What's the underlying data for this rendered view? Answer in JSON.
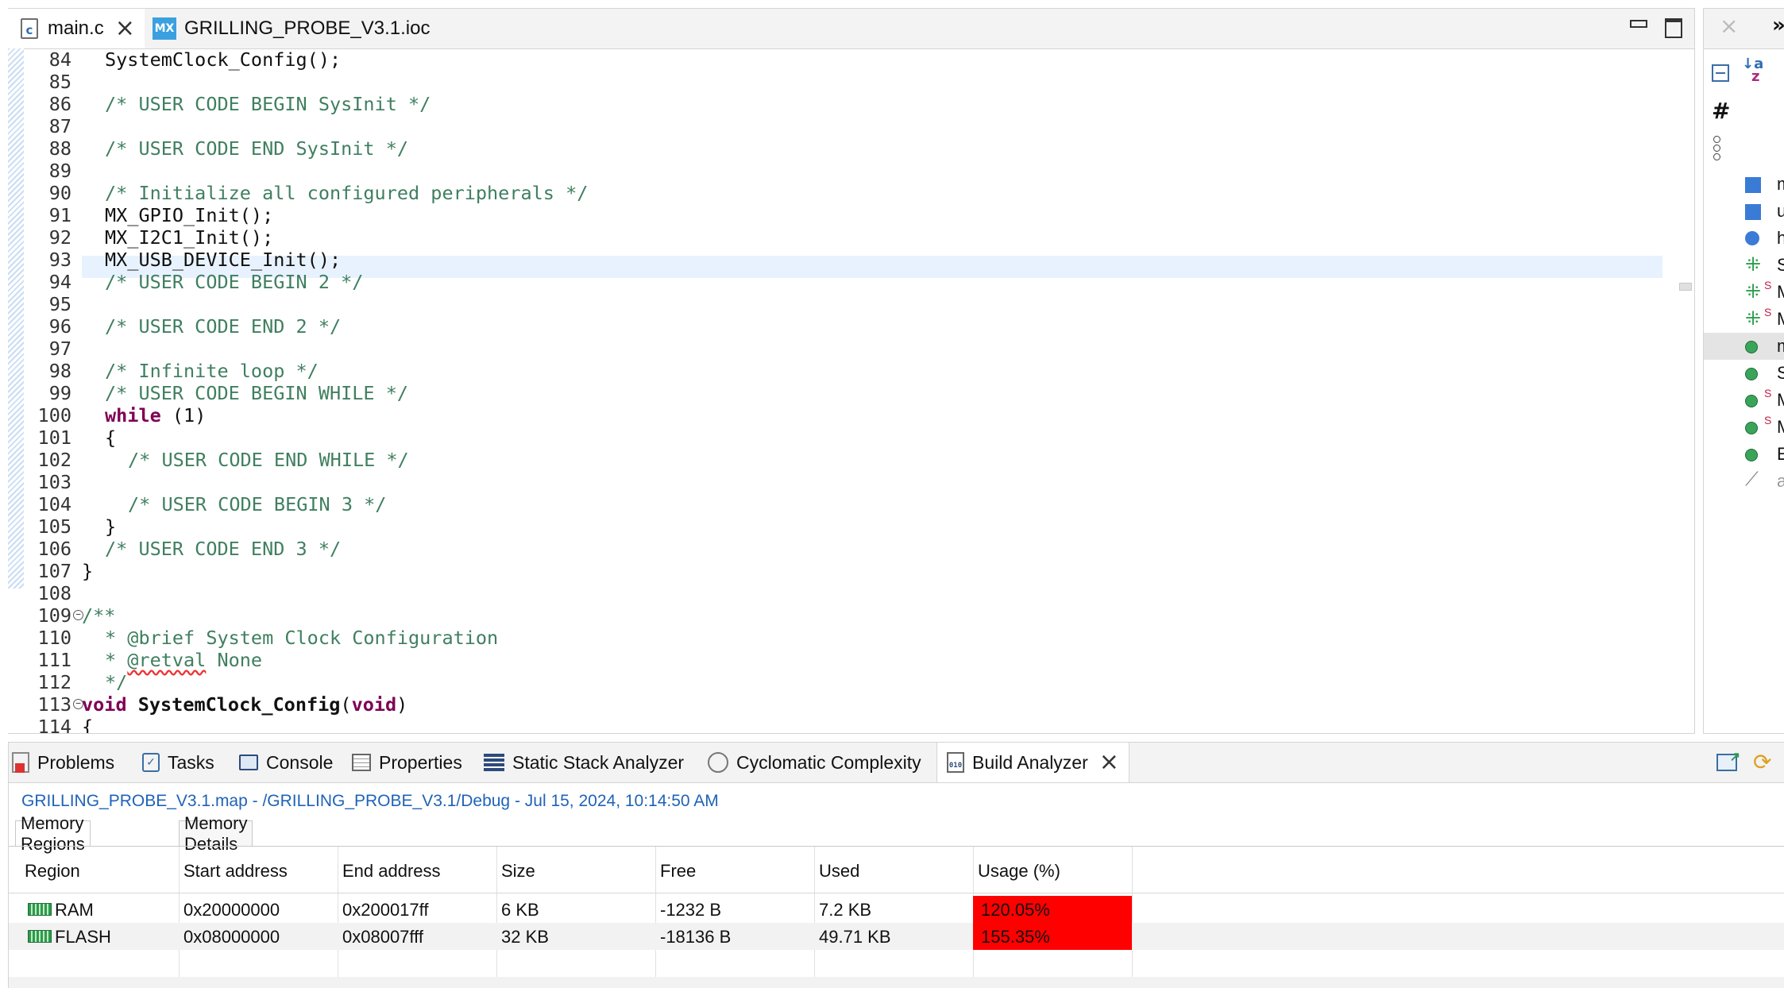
{
  "editor": {
    "tabs": [
      {
        "label": "main.c",
        "icon": "c-file-icon",
        "active": true
      },
      {
        "label": "GRILLING_PROBE_V3.1.ioc",
        "icon": "mx-icon",
        "active": false
      }
    ],
    "lines": [
      {
        "n": "84",
        "t": "SystemClock_Config();"
      },
      {
        "n": "85",
        "t": ""
      },
      {
        "n": "86",
        "t": "/* USER CODE BEGIN SysInit */"
      },
      {
        "n": "87",
        "t": ""
      },
      {
        "n": "88",
        "t": "/* USER CODE END SysInit */"
      },
      {
        "n": "89",
        "t": ""
      },
      {
        "n": "90",
        "t": "/* Initialize all configured peripherals */"
      },
      {
        "n": "91",
        "t": "MX_GPIO_Init();"
      },
      {
        "n": "92",
        "t": "MX_I2C1_Init();"
      },
      {
        "n": "93",
        "t": "MX_USB_DEVICE_Init();"
      },
      {
        "n": "94",
        "t": "/* USER CODE BEGIN 2 */"
      },
      {
        "n": "95",
        "t": ""
      },
      {
        "n": "96",
        "t": "/* USER CODE END 2 */"
      },
      {
        "n": "97",
        "t": ""
      },
      {
        "n": "98",
        "t": "/* Infinite loop */"
      },
      {
        "n": "99",
        "t": "/* USER CODE BEGIN WHILE */"
      },
      {
        "n": "100",
        "t": "while",
        "t2": " (1)"
      },
      {
        "n": "101",
        "t": "{"
      },
      {
        "n": "102",
        "t": "/* USER CODE END WHILE */"
      },
      {
        "n": "103",
        "t": ""
      },
      {
        "n": "104",
        "t": "/* USER CODE BEGIN 3 */"
      },
      {
        "n": "105",
        "t": "}"
      },
      {
        "n": "106",
        "t": "/* USER CODE END 3 */"
      },
      {
        "n": "107",
        "t": "}"
      },
      {
        "n": "108",
        "t": ""
      },
      {
        "n": "109",
        "t": "/**"
      },
      {
        "n": "110",
        "t": "* @brief System Clock Configuration"
      },
      {
        "n": "111",
        "t": "* ",
        "t2": "@retval",
        "t3": " None"
      },
      {
        "n": "112",
        "t": "*/"
      },
      {
        "n": "113",
        "t": "void",
        "t2": " SystemClock_Config",
        "t3": "(",
        "t4": "void",
        "t5": ")"
      },
      {
        "n": "114",
        "t": "{"
      }
    ]
  },
  "outline": {
    "labels": [
      "m",
      "u",
      "h",
      "S",
      "M",
      "M",
      "m",
      "S",
      "M",
      "M",
      "E",
      "a"
    ]
  },
  "bottom": {
    "tabs": [
      {
        "label": "Problems",
        "icon": "problems-icon"
      },
      {
        "label": "Tasks",
        "icon": "tasks-icon"
      },
      {
        "label": "Console",
        "icon": "console-icon"
      },
      {
        "label": "Properties",
        "icon": "properties-icon"
      },
      {
        "label": "Static Stack Analyzer",
        "icon": "stack-analyzer-icon"
      },
      {
        "label": "Cyclomatic Complexity",
        "icon": "cyclomatic-icon"
      },
      {
        "label": "Build Analyzer",
        "icon": "build-analyzer-icon"
      }
    ],
    "path": "GRILLING_PROBE_V3.1.map - /GRILLING_PROBE_V3.1/Debug - Jul 15, 2024, 10:14:50 AM",
    "subtabs": [
      "Memory Regions",
      "Memory Details"
    ],
    "columns": [
      "Region",
      "Start address",
      "End address",
      "Size",
      "Free",
      "Used",
      "Usage (%)"
    ],
    "rows": [
      {
        "region": "RAM",
        "start": "0x20000000",
        "end": "0x200017ff",
        "size": "6 KB",
        "free": "-1232 B",
        "used": "7.2 KB",
        "usage": "120.05%"
      },
      {
        "region": "FLASH",
        "start": "0x08000000",
        "end": "0x08007fff",
        "size": "32 KB",
        "free": "-18136 B",
        "used": "49.71 KB",
        "usage": "155.35%"
      }
    ],
    "usage_color": "#ff0000"
  }
}
